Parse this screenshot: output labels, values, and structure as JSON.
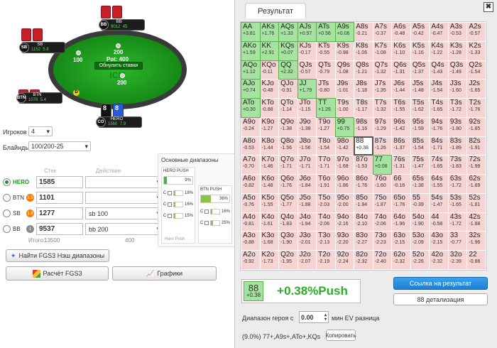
{
  "table": {
    "pot_label": "Pot: 400",
    "reset_label": "Обнулить ставки",
    "watermark": "ICM"
  },
  "players": {
    "bb": {
      "pos": "BB",
      "name": "BB",
      "stack": "9012",
      "bb": "45"
    },
    "sb": {
      "pos": "SB",
      "name": "SB",
      "stack": "1152",
      "bb": "5.8"
    },
    "btn": {
      "pos": "BTN",
      "name": "BTN",
      "stack": "1076",
      "bb": "5.4"
    },
    "co": {
      "pos": "CO",
      "name": "HERO",
      "stack": "1560",
      "bb": "7.9",
      "card1": "8",
      "card2": "8"
    }
  },
  "bets": {
    "bb": "200",
    "sb": "100"
  },
  "dealer": "D",
  "settings": {
    "players_label": "Игроков",
    "players_value": "4",
    "blinds_label": "Блайнды",
    "blinds_value": "100/200-25"
  },
  "stacks_header": {
    "stack": "Стек",
    "action": "Действие"
  },
  "seat_rows": [
    {
      "name": "HERO",
      "badge": "",
      "stack": "1585",
      "action": ""
    },
    {
      "name": "BTN",
      "badge": "1.5",
      "stack": "1101",
      "action": ""
    },
    {
      "name": "SB",
      "badge": "1.9",
      "stack": "1277",
      "action": "sb 100"
    },
    {
      "name": "BB",
      "badge": "1",
      "stack": "9537",
      "action": "bb 200"
    }
  ],
  "totals": {
    "label": "Итого:",
    "stack": "13500",
    "action": "400"
  },
  "ranges": {
    "title": "Основные диапазоны",
    "hero_push": {
      "title": "HERO PUSH",
      "pct": "9%",
      "rows": [
        "18%",
        "16%",
        "15%"
      ],
      "footer": "Hero Push"
    },
    "btn_push": {
      "title": "BTN PUSH",
      "pct": "36%",
      "rows": [
        "16%",
        "25%"
      ]
    }
  },
  "buttons": {
    "fgs3_nash": "Найти FGS3 Нэш диапазоны",
    "fgs3_calc": "Расчёт FGS3",
    "charts": "Графики"
  },
  "panel": {
    "tab": "Результат",
    "close": "✖",
    "result_hand": "88",
    "result_ev": "+0.38",
    "result_text": "+0.38%Push",
    "link_button": "Ссылка на результат",
    "detail_button": "88 детализация",
    "hero_range_label": "Диапазон героя с",
    "hero_range_value": "0.00",
    "hero_range_suffix": "мин EV разница",
    "range_summary": "(9.0%) 77+,A9s+,ATo+,KQs",
    "copy_button": "Копировать"
  },
  "grid": [
    [
      [
        "AA",
        "+3.81",
        "p"
      ],
      [
        "AKs",
        "+1.76",
        "p"
      ],
      [
        "AQs",
        "+1.33",
        "p"
      ],
      [
        "AJs",
        "+0.97",
        "p"
      ],
      [
        "ATs",
        "+0.56",
        "p"
      ],
      [
        "A9s",
        "+0.06",
        "p"
      ],
      [
        "A8s",
        "-0.21",
        "f"
      ],
      [
        "A7s",
        "-0.37",
        "f"
      ],
      [
        "A6s",
        "-0.48",
        "f"
      ],
      [
        "A5s",
        "-0.42",
        "f"
      ],
      [
        "A4s",
        "-0.47",
        "f"
      ],
      [
        "A3s",
        "-0.53",
        "f"
      ],
      [
        "A2s",
        "-0.57",
        "f"
      ]
    ],
    [
      [
        "AKo",
        "+1.59",
        "p"
      ],
      [
        "KK",
        "+2.91",
        "p"
      ],
      [
        "KQs",
        "+0.07",
        "p"
      ],
      [
        "KJs",
        "-0.17",
        "f"
      ],
      [
        "KTs",
        "-0.55",
        "f"
      ],
      [
        "K9s",
        "-0.98",
        "f"
      ],
      [
        "K8s",
        "-1.06",
        "f"
      ],
      [
        "K7s",
        "-1.08",
        "f"
      ],
      [
        "K6s",
        "-1.10",
        "f"
      ],
      [
        "K5s",
        "-1.16",
        "f"
      ],
      [
        "K4s",
        "-1.22",
        "f"
      ],
      [
        "K3s",
        "-1.28",
        "f"
      ],
      [
        "K2s",
        "-1.33",
        "f"
      ]
    ],
    [
      [
        "AQo",
        "+1.12",
        "p"
      ],
      [
        "KQo",
        "-0.11",
        "f"
      ],
      [
        "QQ",
        "+2.32",
        "p"
      ],
      [
        "QJs",
        "-0.57",
        "f"
      ],
      [
        "QTs",
        "-0.79",
        "f"
      ],
      [
        "Q9s",
        "-1.08",
        "f"
      ],
      [
        "Q8s",
        "-1.21",
        "f"
      ],
      [
        "Q7s",
        "-1.32",
        "f"
      ],
      [
        "Q6s",
        "-1.31",
        "f"
      ],
      [
        "Q5s",
        "-1.37",
        "f"
      ],
      [
        "Q4s",
        "-1.43",
        "f"
      ],
      [
        "Q3s",
        "-1.49",
        "f"
      ],
      [
        "Q2s",
        "-1.54",
        "f"
      ]
    ],
    [
      [
        "AJo",
        "+0.74",
        "p"
      ],
      [
        "KJo",
        "-0.48",
        "f"
      ],
      [
        "QJo",
        "-0.91",
        "f"
      ],
      [
        "JJ",
        "+1.79",
        "p"
      ],
      [
        "JTs",
        "-0.80",
        "f"
      ],
      [
        "J9s",
        "-1.01",
        "f"
      ],
      [
        "J8s",
        "-1.18",
        "f"
      ],
      [
        "J7s",
        "-1.35",
        "f"
      ],
      [
        "J6s",
        "-1.44",
        "f"
      ],
      [
        "J5s",
        "-1.48",
        "f"
      ],
      [
        "J4s",
        "-1.54",
        "f"
      ],
      [
        "J3s",
        "-1.60",
        "f"
      ],
      [
        "J2s",
        "-1.65",
        "f"
      ]
    ],
    [
      [
        "ATo",
        "+0.30",
        "p"
      ],
      [
        "KTo",
        "-0.88",
        "f"
      ],
      [
        "QTo",
        "-1.14",
        "f"
      ],
      [
        "JTo",
        "-1.15",
        "f"
      ],
      [
        "TT",
        "+1.26",
        "p"
      ],
      [
        "T9s",
        "-1.00",
        "f"
      ],
      [
        "T8s",
        "-1.17",
        "f"
      ],
      [
        "T7s",
        "-1.32",
        "f"
      ],
      [
        "T6s",
        "-1.55",
        "f"
      ],
      [
        "T5s",
        "-1.62",
        "f"
      ],
      [
        "T4s",
        "-1.65",
        "f"
      ],
      [
        "T3s",
        "-1.72",
        "f"
      ],
      [
        "T2s",
        "-1.76",
        "f"
      ]
    ],
    [
      [
        "A9o",
        "-0.24",
        "f"
      ],
      [
        "K9o",
        "-1.27",
        "f"
      ],
      [
        "Q9o",
        "-1.38",
        "f"
      ],
      [
        "J9o",
        "-1.38",
        "f"
      ],
      [
        "T9o",
        "-1.27",
        "f"
      ],
      [
        "99",
        "+0.75",
        "p"
      ],
      [
        "98s",
        "-1.16",
        "f"
      ],
      [
        "97s",
        "-1.29",
        "f"
      ],
      [
        "96s",
        "-1.42",
        "f"
      ],
      [
        "95s",
        "-1.59",
        "f"
      ],
      [
        "94s",
        "-1.76",
        "f"
      ],
      [
        "93s",
        "-1.80",
        "f"
      ],
      [
        "92s",
        "-1.85",
        "f"
      ]
    ],
    [
      [
        "A8o",
        "-0.53",
        "f"
      ],
      [
        "K8o",
        "-1.44",
        "f"
      ],
      [
        "Q8o",
        "-1.56",
        "f"
      ],
      [
        "J8o",
        "-1.56",
        "f"
      ],
      [
        "T8o",
        "-1.54",
        "f"
      ],
      [
        "98o",
        "-1.42",
        "f"
      ],
      [
        "88",
        "+0.38",
        "hl"
      ],
      [
        "87s",
        "-1.26",
        "f"
      ],
      [
        "86s",
        "-1.37",
        "f"
      ],
      [
        "85s",
        "-1.54",
        "f"
      ],
      [
        "84s",
        "-1.71",
        "f"
      ],
      [
        "83s",
        "-1.89",
        "f"
      ],
      [
        "82s",
        "-1.91",
        "f"
      ]
    ],
    [
      [
        "A7o",
        "-0.70",
        "f"
      ],
      [
        "K7o",
        "-1.46",
        "f"
      ],
      [
        "Q7o",
        "-1.71",
        "f"
      ],
      [
        "J7o",
        "-1.71",
        "f"
      ],
      [
        "T7o",
        "-1.71",
        "f"
      ],
      [
        "97o",
        "-1.68",
        "f"
      ],
      [
        "87o",
        "-1.53",
        "f"
      ],
      [
        "77",
        "+0.08",
        "p"
      ],
      [
        "76s",
        "-1.31",
        "f"
      ],
      [
        "75s",
        "-1.47",
        "f"
      ],
      [
        "74s",
        "-1.65",
        "f"
      ],
      [
        "73s",
        "-1.83",
        "f"
      ],
      [
        "72s",
        "-1.99",
        "f"
      ]
    ],
    [
      [
        "A6o",
        "-0.82",
        "f"
      ],
      [
        "K6o",
        "-1.48",
        "f"
      ],
      [
        "Q6o",
        "-1.76",
        "f"
      ],
      [
        "J6o",
        "-1.84",
        "f"
      ],
      [
        "T6o",
        "-1.91",
        "f"
      ],
      [
        "96o",
        "-1.86",
        "f"
      ],
      [
        "86o",
        "-1.76",
        "f"
      ],
      [
        "76o",
        "-1.60",
        "f"
      ],
      [
        "66",
        "-0.16",
        "f"
      ],
      [
        "65s",
        "-1.38",
        "f"
      ],
      [
        "64s",
        "-1.55",
        "f"
      ],
      [
        "63s",
        "-1.72",
        "f"
      ],
      [
        "62s",
        "-1.89",
        "f"
      ]
    ],
    [
      [
        "A5o",
        "-0.76",
        "f"
      ],
      [
        "K5o",
        "-1.55",
        "f"
      ],
      [
        "Q5o",
        "-1.77",
        "f"
      ],
      [
        "J5o",
        "-1.88",
        "f"
      ],
      [
        "T5o",
        "-2.03",
        "f"
      ],
      [
        "95o",
        "-2.00",
        "f"
      ],
      [
        "85o",
        "-1.94",
        "f"
      ],
      [
        "75o",
        "-1.87",
        "f"
      ],
      [
        "65o",
        "-1.76",
        "f"
      ],
      [
        "55",
        "-0.39",
        "f"
      ],
      [
        "54s",
        "-1.47",
        "f"
      ],
      [
        "53s",
        "-1.65",
        "f"
      ],
      [
        "52s",
        "-1.81",
        "f"
      ]
    ],
    [
      [
        "A4o",
        "-0.81",
        "f"
      ],
      [
        "K4o",
        "-1.61",
        "f"
      ],
      [
        "Q4o",
        "-1.83",
        "f"
      ],
      [
        "J4o",
        "-1.94",
        "f"
      ],
      [
        "T4o",
        "-2.06",
        "f"
      ],
      [
        "94o",
        "-2.16",
        "f"
      ],
      [
        "84o",
        "-2.10",
        "f"
      ],
      [
        "74o",
        "-2.06",
        "f"
      ],
      [
        "64o",
        "-1.96",
        "f"
      ],
      [
        "54o",
        "-1.90",
        "f"
      ],
      [
        "44",
        "-0.58",
        "f"
      ],
      [
        "43s",
        "-1.72",
        "f"
      ],
      [
        "42s",
        "-1.88",
        "f"
      ]
    ],
    [
      [
        "A3o",
        "-0.88",
        "f"
      ],
      [
        "K3o",
        "-1.68",
        "f"
      ],
      [
        "Q3o",
        "-1.90",
        "f"
      ],
      [
        "J3o",
        "-2.01",
        "f"
      ],
      [
        "T3o",
        "-2.13",
        "f"
      ],
      [
        "93o",
        "-2.20",
        "f"
      ],
      [
        "83o",
        "-2.27",
        "f"
      ],
      [
        "73o",
        "-2.23",
        "f"
      ],
      [
        "63o",
        "-2.15",
        "f"
      ],
      [
        "53o",
        "-2.09",
        "f"
      ],
      [
        "43o",
        "-2.15",
        "f"
      ],
      [
        "33",
        "-0.77",
        "f"
      ],
      [
        "32s",
        "-1.96",
        "f"
      ]
    ],
    [
      [
        "A2o",
        "-0.92",
        "f"
      ],
      [
        "K2o",
        "-1.73",
        "f"
      ],
      [
        "Q2o",
        "-1.95",
        "f"
      ],
      [
        "J2o",
        "-2.07",
        "f"
      ],
      [
        "T2o",
        "-2.19",
        "f"
      ],
      [
        "92o",
        "-2.24",
        "f"
      ],
      [
        "82o",
        "-2.32",
        "f"
      ],
      [
        "72o",
        "-2.40",
        "f"
      ],
      [
        "62o",
        "-2.32",
        "f"
      ],
      [
        "52o",
        "-2.26",
        "f"
      ],
      [
        "42o",
        "-2.32",
        "f"
      ],
      [
        "32o",
        "-2.39",
        "f"
      ],
      [
        "22",
        "-0.86",
        "f"
      ]
    ]
  ]
}
